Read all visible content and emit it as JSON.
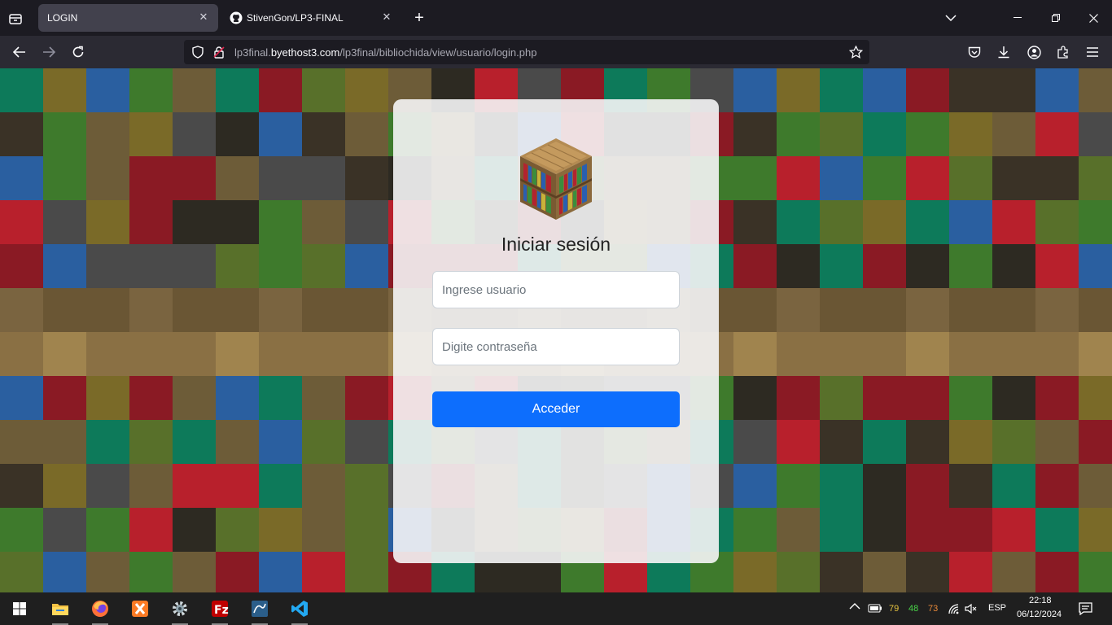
{
  "browser": {
    "tabs": [
      {
        "title": "LOGIN",
        "active": true
      },
      {
        "title": "StivenGon/LP3-FINAL",
        "active": false
      }
    ],
    "url_prefix": "lp3final.",
    "url_domain": "byethost3.com",
    "url_path": "/lp3final/bibliochida/view/usuario/login.php"
  },
  "login": {
    "title": "Iniciar sesión",
    "username_placeholder": "Ingrese usuario",
    "password_placeholder": "Digite contraseña",
    "submit_label": "Acceder",
    "accent_color": "#0d6efd"
  },
  "taskbar": {
    "apps": [
      "start-icon",
      "file-explorer-icon",
      "firefox-icon",
      "xampp-icon",
      "settings-icon",
      "filezilla-icon",
      "mysql-workbench-icon",
      "vscode-icon"
    ],
    "tray_numbers": [
      "79",
      "48",
      "73"
    ],
    "language": "ESP",
    "time": "22:18",
    "date": "06/12/2024"
  }
}
